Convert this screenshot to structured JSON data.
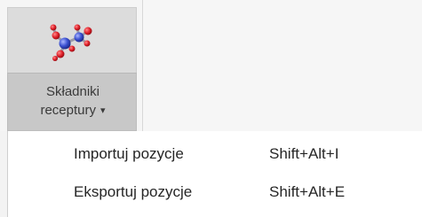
{
  "ribbon": {
    "button": {
      "label_line1": "Składniki",
      "label_line2": "receptury",
      "icon": "molecule-icon",
      "dropdown_icon": "caret-down-icon",
      "caret_glyph": "▾"
    }
  },
  "menu": {
    "items": [
      {
        "label": "Importuj pozycje",
        "shortcut": "Shift+Alt+I"
      },
      {
        "label": "Eksportuj pozycje",
        "shortcut": "Shift+Alt+E"
      }
    ]
  },
  "colors": {
    "ribbon_bg": "#f5f5f5",
    "button_pressed_bg": "#c8c8c8",
    "button_top_bg": "#dcdcdc",
    "menu_bg": "#ffffff",
    "text": "#262626",
    "atom_red": "#e0202a",
    "atom_blue": "#3a4fd0"
  }
}
